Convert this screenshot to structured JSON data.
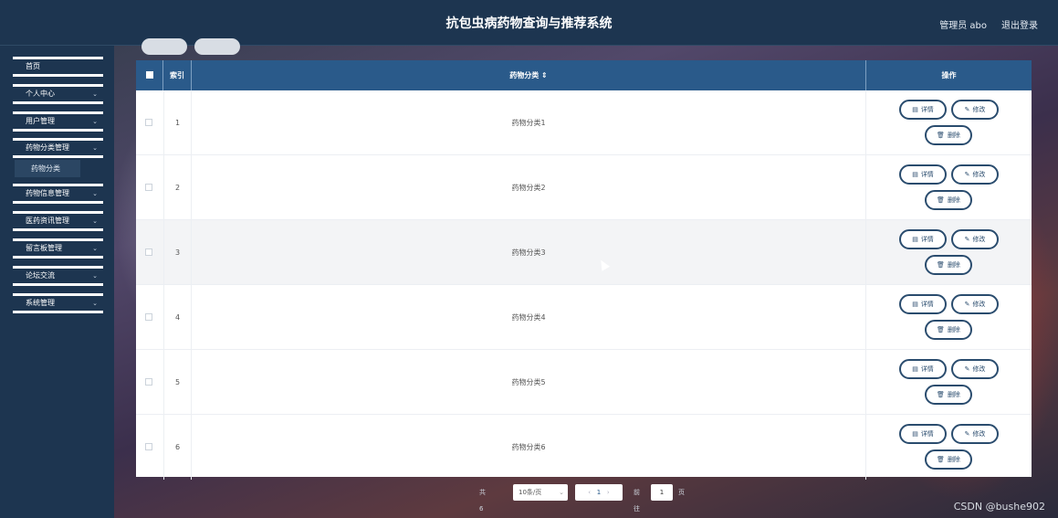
{
  "header": {
    "title": "抗包虫病药物查询与推荐系统",
    "user": "管理员 abo",
    "logout": "退出登录"
  },
  "sidebar": {
    "items": [
      {
        "label": "首页",
        "chevron": ""
      },
      {
        "label": "个人中心",
        "chevron": "⌄"
      },
      {
        "label": "用户管理",
        "chevron": "⌄"
      },
      {
        "label": "药物分类管理",
        "chevron": "⌄"
      },
      {
        "label": "药物信息管理",
        "chevron": "⌄"
      },
      {
        "label": "医药资讯管理",
        "chevron": "⌄"
      },
      {
        "label": "留言板管理",
        "chevron": "⌄"
      },
      {
        "label": "论坛交流",
        "chevron": "⌄"
      },
      {
        "label": "系统管理",
        "chevron": "⌄"
      }
    ],
    "active_sub": "药物分类"
  },
  "table": {
    "headers": {
      "index": "索引",
      "category": "药物分类 ⇕",
      "ops": "操作"
    },
    "rows": [
      {
        "index": "1",
        "category": "药物分类1"
      },
      {
        "index": "2",
        "category": "药物分类2"
      },
      {
        "index": "3",
        "category": "药物分类3"
      },
      {
        "index": "4",
        "category": "药物分类4"
      },
      {
        "index": "5",
        "category": "药物分类5"
      },
      {
        "index": "6",
        "category": "药物分类6"
      }
    ],
    "buttons": {
      "detail": "详情",
      "edit": "修改",
      "delete": "删除"
    },
    "icons": {
      "detail": "list-icon",
      "edit": "pencil-icon",
      "delete": "trash-icon"
    }
  },
  "pagination": {
    "total": "共 6 条",
    "page_size": "10条/页",
    "prev": "‹",
    "current": "1",
    "next": "›",
    "goto": "前往",
    "goto_value": "1",
    "unit": "页"
  },
  "watermark": "CSDN @bushe902",
  "colors": {
    "header_bg": "#1d3550",
    "table_head": "#2a5a8a",
    "button_border": "#2a4c6e"
  }
}
